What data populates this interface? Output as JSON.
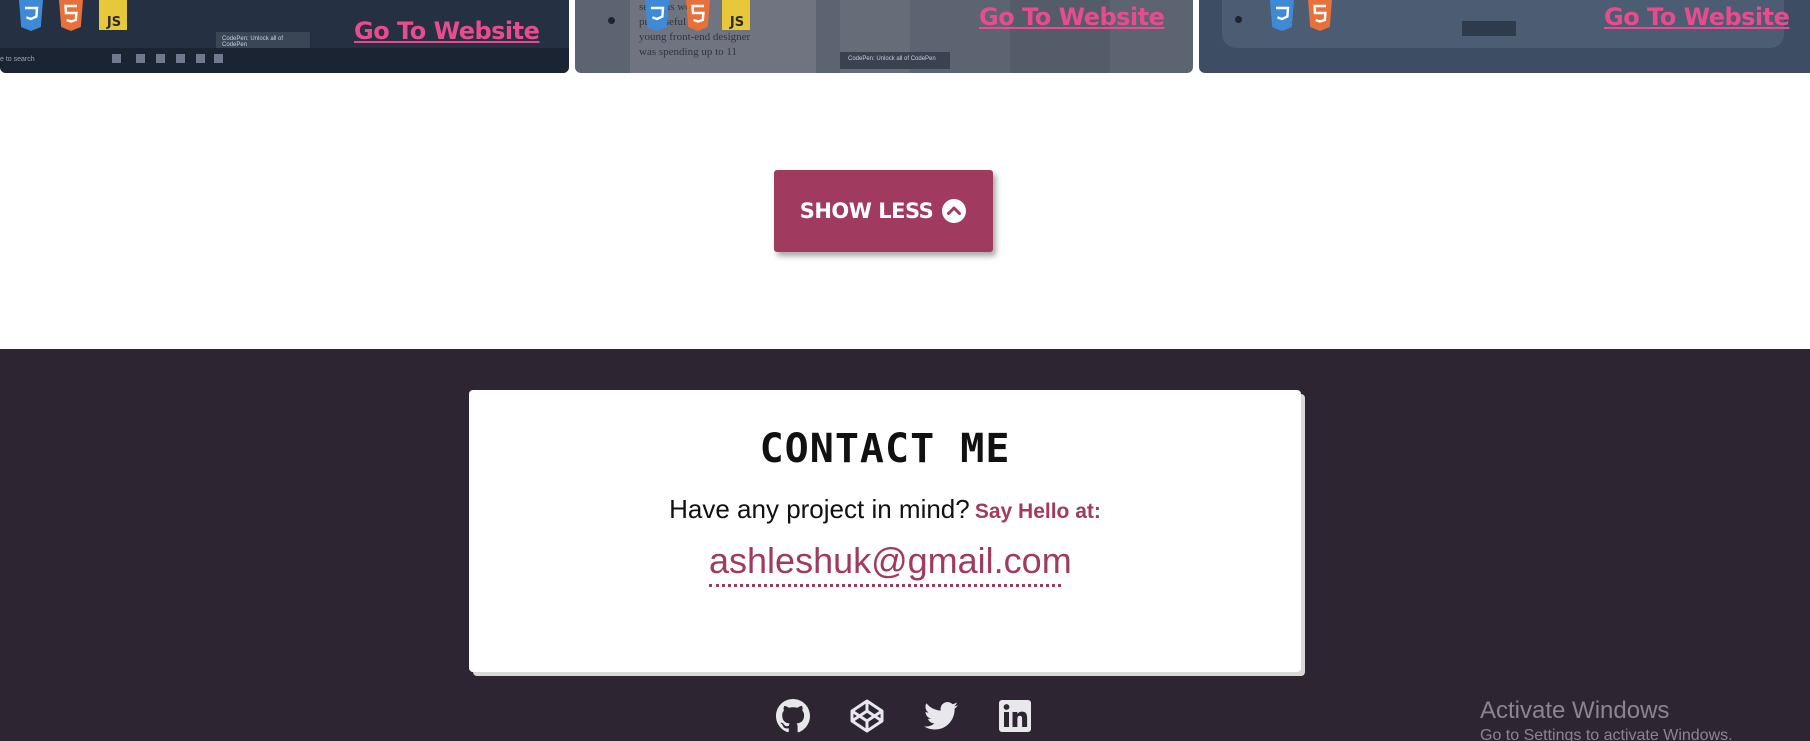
{
  "projects": [
    {
      "link_label": "Go To Website",
      "tech": [
        "css3-icon",
        "html5-icon",
        "js-icon"
      ],
      "taskbar_label": "CodePen: Unlock all of CodePen",
      "search_text": "e to search"
    },
    {
      "link_label": "Go To Website",
      "tech": [
        "css3-icon",
        "html5-icon",
        "js-icon"
      ],
      "taskbar_label": "CodePen: Unlock all of CodePen",
      "paper_lines": [
        "sections would",
        "purposeful with",
        "young front-end designer",
        "was spending up to 11"
      ]
    },
    {
      "link_label": "Go To Website",
      "tech": [
        "css3-icon",
        "html5-icon"
      ]
    }
  ],
  "show_less": {
    "label": "SHOW LESS",
    "icon": "chevron-up-circle-icon"
  },
  "contact": {
    "title": "CONTACT ME",
    "question": "Have any project in mind?",
    "hello": "Say Hello at:",
    "email": "ashleshuk@gmail.com"
  },
  "socials": [
    "github-icon",
    "codepen-icon",
    "twitter-icon",
    "linkedin-icon"
  ],
  "windows_notice": {
    "title": "Activate Windows",
    "subtitle": "Go to Settings to activate Windows."
  },
  "colors": {
    "accent": "#a03a5e",
    "link_pink": "#e94b8e",
    "footer_bg": "#2e2533",
    "card_bg": "#ffffff"
  }
}
